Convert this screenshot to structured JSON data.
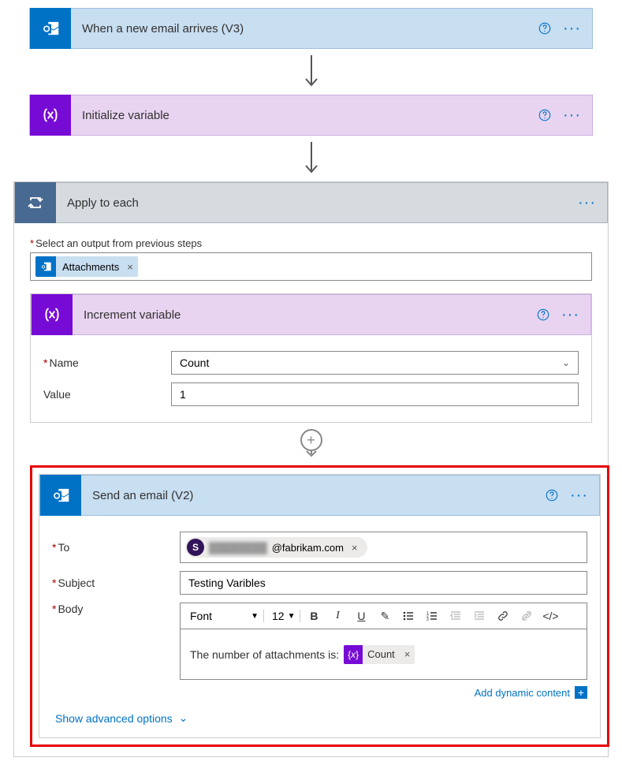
{
  "steps": {
    "email_trigger": {
      "title": "When a new email arrives (V3)"
    },
    "init_var": {
      "title": "Initialize variable"
    },
    "apply_each": {
      "title": "Apply to each",
      "select_label": "Select an output from previous steps",
      "token": "Attachments"
    },
    "increment_var": {
      "title": "Increment variable",
      "name_label": "Name",
      "name_value": "Count",
      "value_label": "Value",
      "value_value": "1"
    },
    "send_email": {
      "title": "Send an email (V2)",
      "to_label": "To",
      "to_chip_initial": "S",
      "to_chip_domain": "@fabrikam.com",
      "subject_label": "Subject",
      "subject_value": "Testing Varibles",
      "body_label": "Body",
      "font_label": "Font",
      "font_size": "12",
      "body_text": "The number of attachments is:",
      "body_token": "Count"
    }
  },
  "ui": {
    "add_dynamic": "Add dynamic content",
    "show_advanced": "Show advanced options"
  }
}
